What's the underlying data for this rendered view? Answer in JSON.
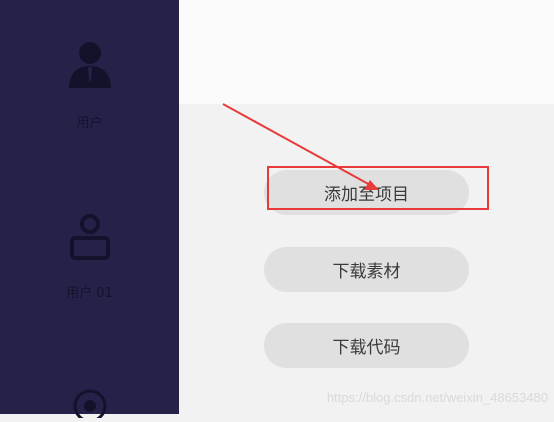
{
  "sidebar": {
    "items": [
      {
        "label": "用户",
        "icon": "user-avatar-icon"
      },
      {
        "label": "用户 01",
        "icon": "user-outline-icon"
      },
      {
        "label": "",
        "icon": "gear-icon"
      }
    ]
  },
  "actions": {
    "add_to_project": "添加至项目",
    "download_assets": "下载素材",
    "download_code": "下载代码"
  },
  "watermark": "https://blog.csdn.net/weixin_48653480",
  "colors": {
    "sidebar_bg": "#25224a",
    "sidebar_icon": "#14122b",
    "button_bg": "#e0e0e0",
    "annotation_red": "#e83a3a"
  }
}
